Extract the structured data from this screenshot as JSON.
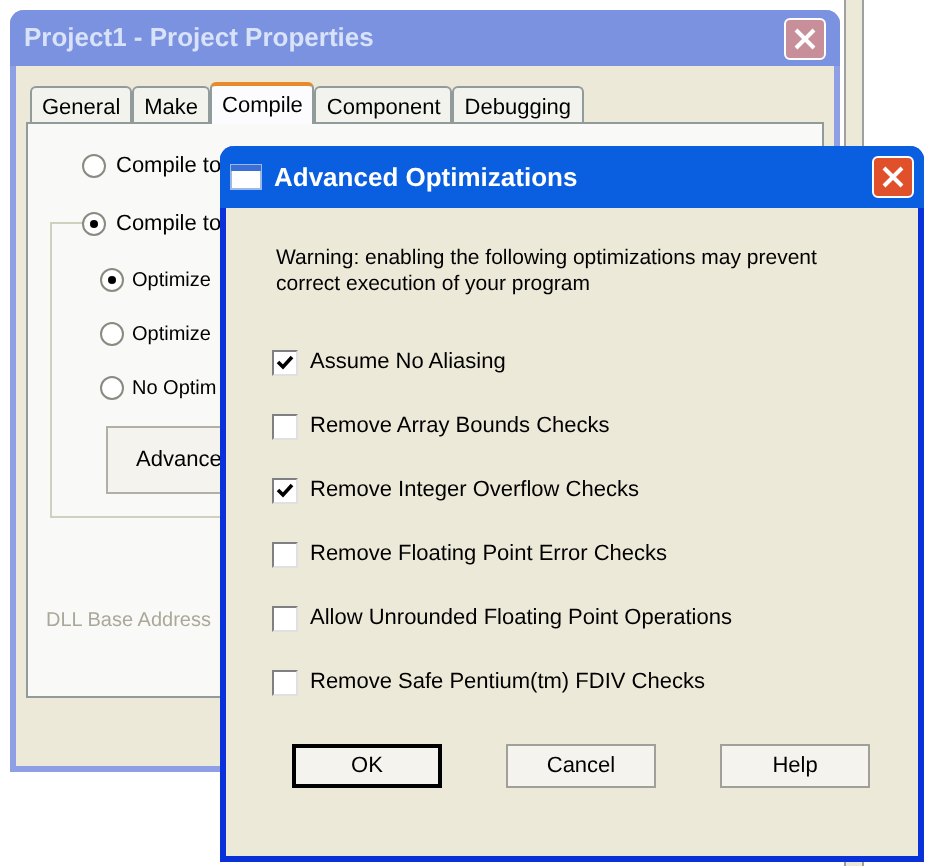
{
  "background_window": {
    "title": "Project1 - Project Properties",
    "tabs": [
      {
        "label": "General",
        "selected": false
      },
      {
        "label": "Make",
        "selected": false
      },
      {
        "label": "Compile",
        "selected": true
      },
      {
        "label": "Component",
        "selected": false
      },
      {
        "label": "Debugging",
        "selected": false
      }
    ],
    "compile_options": [
      {
        "label": "Compile to",
        "selected": false
      },
      {
        "label": "Compile to",
        "selected": true
      }
    ],
    "optimize_options": [
      {
        "label": "Optimize",
        "selected": true
      },
      {
        "label": "Optimize",
        "selected": false
      },
      {
        "label": "No Optim",
        "selected": false
      }
    ],
    "advanced_button": "Advance",
    "dll_base_address_label": "DLL Base Address"
  },
  "dialog": {
    "title": "Advanced Optimizations",
    "warning": "Warning: enabling the following optimizations may prevent correct execution of your program",
    "options": [
      {
        "label": "Assume No Aliasing",
        "checked": true
      },
      {
        "label": "Remove Array Bounds Checks",
        "checked": false
      },
      {
        "label": "Remove Integer Overflow Checks",
        "checked": true
      },
      {
        "label": "Remove Floating Point Error Checks",
        "checked": false
      },
      {
        "label": "Allow Unrounded Floating Point Operations",
        "checked": false
      },
      {
        "label": "Remove Safe Pentium(tm) FDIV Checks",
        "checked": false
      }
    ],
    "buttons": [
      {
        "label": "OK",
        "default": true
      },
      {
        "label": "Cancel",
        "default": false
      },
      {
        "label": "Help",
        "default": false
      }
    ]
  }
}
